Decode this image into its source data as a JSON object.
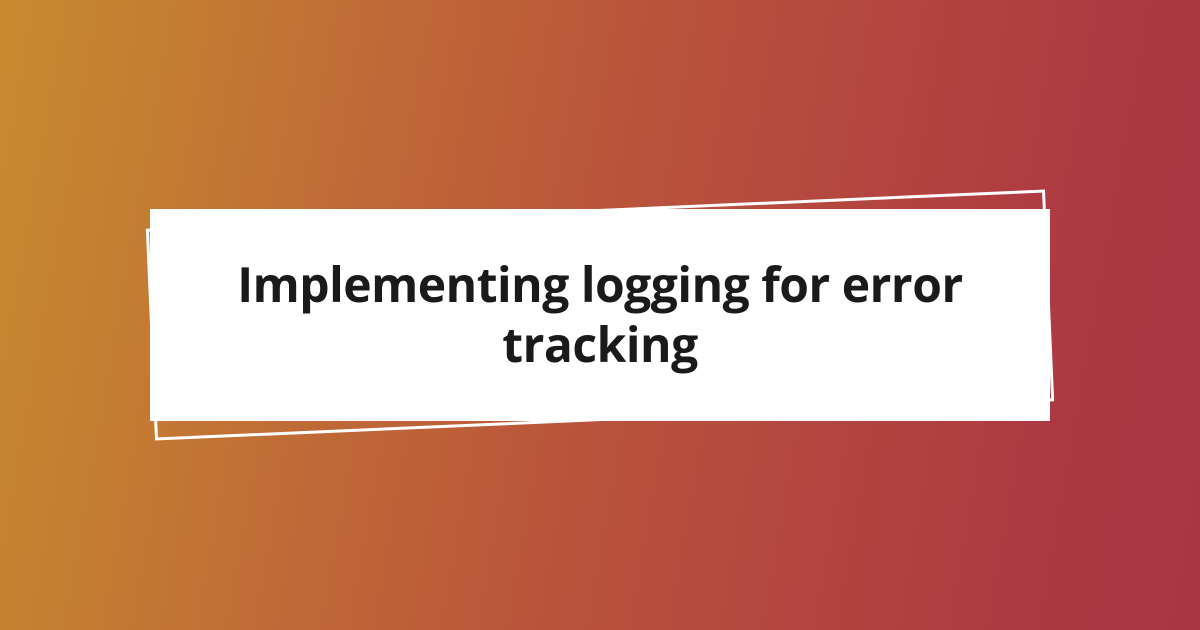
{
  "title": "Implementing logging for error tracking"
}
